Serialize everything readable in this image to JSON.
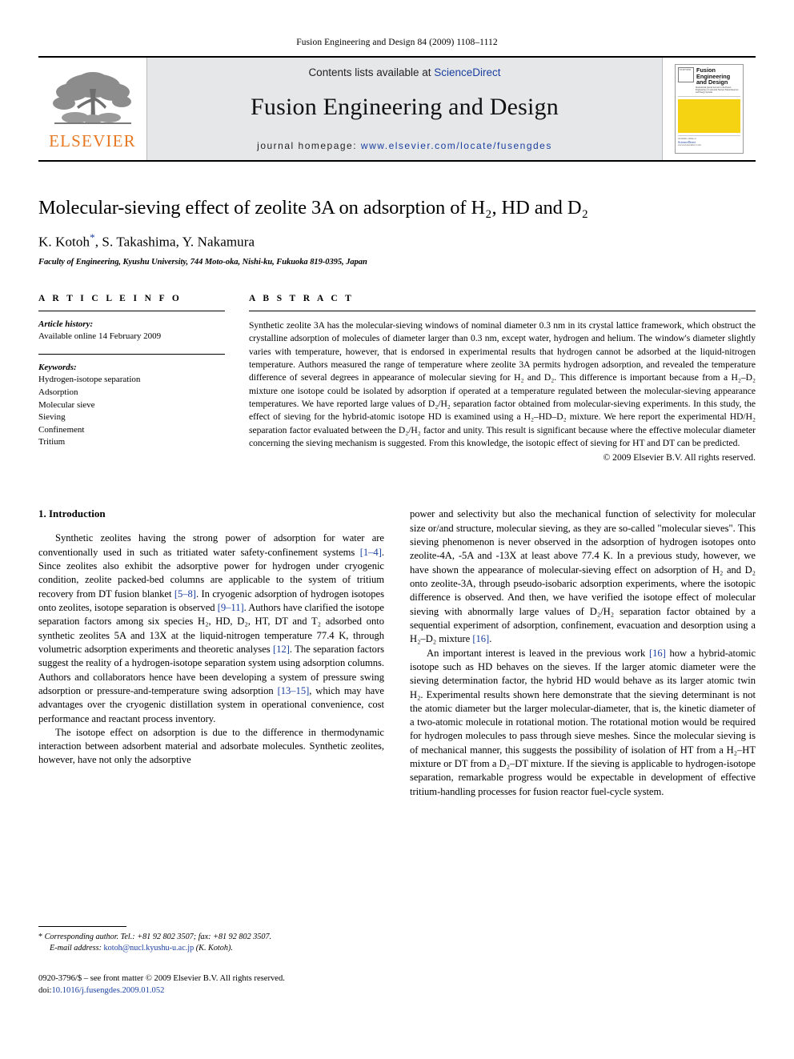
{
  "running_head": "Fusion Engineering and Design 84 (2009) 1108–1112",
  "masthead": {
    "publisher": "ELSEVIER",
    "contents_prefix": "Contents lists available at ",
    "contents_link": "ScienceDirect",
    "journal_name": "Fusion Engineering and Design",
    "homepage_prefix": "journal homepage:",
    "homepage_url": "www.elsevier.com/locate/fusengdes",
    "cover": {
      "title": "Fusion Engineering and Design",
      "subtitle": "International journal devoted to the Fusion Engineering of Controlled Nuclear Fusion Reactors and Energy Systems",
      "badge": "ELSEVIER",
      "footer_label": "Available online at",
      "footer_link": "ScienceDirect",
      "footer_url": "www.sciencedirect.com"
    }
  },
  "article": {
    "title": "Molecular-sieving effect of zeolite 3A on adsorption of H₂, HD and D₂",
    "authors": "K. Kotoh",
    "authors_rest": ", S. Takashima, Y. Nakamura",
    "corresponding_marker": "*",
    "affiliation": "Faculty of Engineering, Kyushu University, 744 Moto-oka, Nishi-ku, Fukuoka 819-0395, Japan"
  },
  "article_info": {
    "heading": "A R T I C L E   I N F O",
    "history_label": "Article history:",
    "history_value": "Available online 14 February 2009",
    "keywords_label": "Keywords:",
    "keywords": [
      "Hydrogen-isotope separation",
      "Adsorption",
      "Molecular sieve",
      "Sieving",
      "Confinement",
      "Tritium"
    ]
  },
  "abstract": {
    "heading": "A B S T R A C T",
    "text": "Synthetic zeolite 3A has the molecular-sieving windows of nominal diameter 0.3 nm in its crystal lattice framework, which obstruct the crystalline adsorption of molecules of diameter larger than 0.3 nm, except water, hydrogen and helium. The window's diameter slightly varies with temperature, however, that is endorsed in experimental results that hydrogen cannot be adsorbed at the liquid-nitrogen temperature. Authors measured the range of temperature where zeolite 3A permits hydrogen adsorption, and revealed the temperature difference of several degrees in appearance of molecular sieving for H₂ and D₂. This difference is important because from a H₂–D₂ mixture one isotope could be isolated by adsorption if operated at a temperature regulated between the molecular-sieving appearance temperatures. We have reported large values of D₂/H₂ separation factor obtained from molecular-sieving experiments. In this study, the effect of sieving for the hybrid-atomic isotope HD is examined using a H₂–HD–D₂ mixture. We here report the experimental HD/H₂ separation factor evaluated between the D₂/H₂ factor and unity. This result is significant because where the effective molecular diameter concerning the sieving mechanism is suggested. From this knowledge, the isotopic effect of sieving for HT and DT can be predicted.",
    "copyright": "© 2009 Elsevier B.V. All rights reserved."
  },
  "body": {
    "section_heading": "1.  Introduction",
    "left_paragraphs": [
      "Synthetic zeolites having the strong power of adsorption for water are conventionally used in such as tritiated water safety-confinement systems [1–4]. Since zeolites also exhibit the adsorptive power for hydrogen under cryogenic condition, zeolite packed-bed columns are applicable to the system of tritium recovery from DT fusion blanket [5–8]. In cryogenic adsorption of hydrogen isotopes onto zeolites, isotope separation is observed [9–11]. Authors have clarified the isotope separation factors among six species H₂, HD, D₂, HT, DT and T₂ adsorbed onto synthetic zeolites 5A and 13X at the liquid-nitrogen temperature 77.4 K, through volumetric adsorption experiments and theoretic analyses [12]. The separation factors suggest the reality of a hydrogen-isotope separation system using adsorption columns. Authors and collaborators hence have been developing a system of pressure swing adsorption or pressure-and-temperature swing adsorption [13–15], which may have advantages over the cryogenic distillation system in operational convenience, cost performance and reactant process inventory.",
      "The isotope effect on adsorption is due to the difference in thermodynamic interaction between adsorbent material and adsorbate molecules. Synthetic zeolites, however, have not only the adsorptive"
    ],
    "right_paragraphs": [
      "power and selectivity but also the mechanical function of selectivity for molecular size or/and structure, molecular sieving, as they are so-called \"molecular sieves\". This sieving phenomenon is never observed in the adsorption of hydrogen isotopes onto zeolite-4A, -5A and -13X at least above 77.4 K. In a previous study, however, we have shown the appearance of molecular-sieving effect on adsorption of H₂ and D₂ onto zeolite-3A, through pseudo-isobaric adsorption experiments, where the isotopic difference is observed. And then, we have verified the isotope effect of molecular sieving with abnormally large values of D₂/H₂ separation factor obtained by a sequential experiment of adsorption, confinement, evacuation and desorption using a H₂–D₂ mixture [16].",
      "An important interest is leaved in the previous work [16] how a hybrid-atomic isotope such as HD behaves on the sieves. If the larger atomic diameter were the sieving determination factor, the hybrid HD would behave as its larger atomic twin H₂. Experimental results shown here demonstrate that the sieving determinant is not the atomic diameter but the larger molecular-diameter, that is, the kinetic diameter of a two-atomic molecule in rotational motion. The rotational motion would be required for hydrogen molecules to pass through sieve meshes. Since the molecular sieving is of mechanical manner, this suggests the possibility of isolation of HT from a H₂–HT mixture or DT from a D₂–DT mixture. If the sieving is applicable to hydrogen-isotope separation, remarkable progress would be expectable in development of effective tritium-handling processes for fusion reactor fuel-cycle system."
    ]
  },
  "footnotes": {
    "corresponding": "Corresponding author. Tel.: +81 92 802 3507; fax: +81 92 802 3507.",
    "email_label": "E-mail address:",
    "email": "kotoh@nucl.kyushu-u.ac.jp",
    "email_suffix": "(K. Kotoh).",
    "issn_line": "0920-3796/$ – see front matter © 2009 Elsevier B.V. All rights reserved.",
    "doi_label": "doi:",
    "doi": "10.1016/j.fusengdes.2009.01.052"
  }
}
